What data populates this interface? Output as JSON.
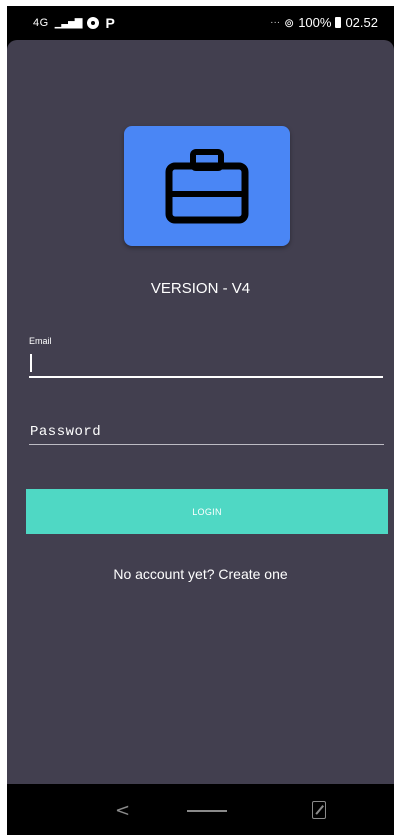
{
  "status_bar": {
    "network": "4G",
    "signal_icon": "signal-bars-icon",
    "app_icon_1": "settings-gear-icon",
    "app_icon_2": "p-icon",
    "more_dots": "···",
    "hotspot_icon": "hotspot-icon",
    "battery_percent": "100%",
    "time": "02.52"
  },
  "app": {
    "logo_icon": "briefcase-icon",
    "version_text": "VERSION - V4",
    "email": {
      "label": "Email",
      "value": ""
    },
    "password": {
      "placeholder": "Password",
      "value": ""
    },
    "login_label": "LOGIN",
    "create_account_text": "No account yet? Create one"
  },
  "nav_bar": {
    "back_icon": "back-chevron-icon",
    "home_icon": "home-bar-icon",
    "recents_icon": "recents-icon"
  },
  "colors": {
    "background": "#423f4f",
    "logo_tile": "#4a86f5",
    "login_button": "#4fd8c4",
    "text": "#ffffff"
  }
}
